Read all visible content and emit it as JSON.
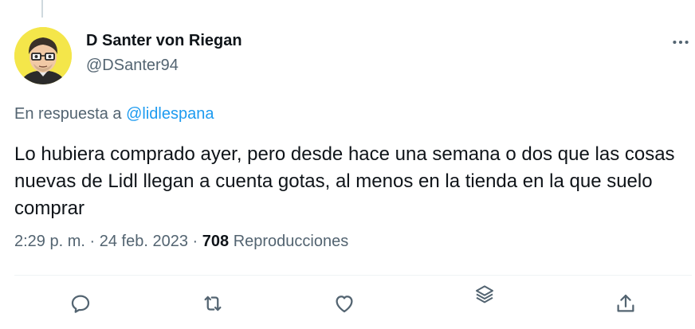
{
  "tweet": {
    "author_name": "D Santer von Riegan",
    "author_handle": "@DSanter94",
    "reply_prefix": "En respuesta a",
    "reply_to_handle": "@lidlespana",
    "text": "Lo hubiera comprado ayer, pero desde hace una semana o dos que las cosas nuevas de Lidl llegan a cuenta gotas, al menos en la tienda en la que suelo comprar",
    "time": "2:29 p. m.",
    "separator": "·",
    "date": "24 feb. 2023",
    "views_count": "708",
    "views_label": "Reproducciones"
  },
  "icons": {
    "more": "more-dots-icon",
    "reply": "reply-icon",
    "retweet": "retweet-icon",
    "like": "heart-icon",
    "views": "views-layers-icon",
    "share": "share-icon"
  },
  "colors": {
    "accent": "#1d9bf0",
    "text_primary": "#0f1419",
    "text_secondary": "#536471",
    "avatar_bg": "#f4e64a"
  }
}
